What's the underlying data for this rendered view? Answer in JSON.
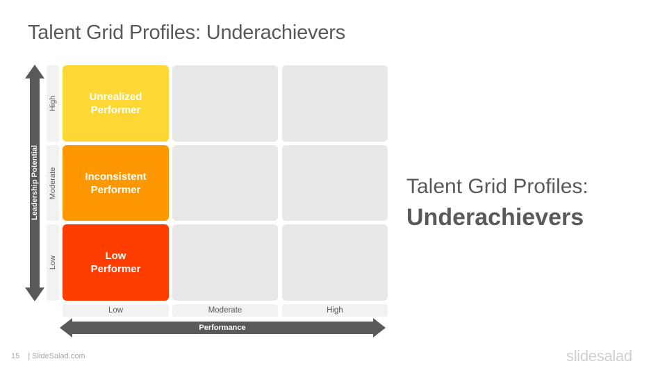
{
  "slide": {
    "title": "Talent Grid Profiles: Underachievers",
    "side_title_line1": "Talent Grid Profiles:",
    "side_title_line2": "Underachievers",
    "page_number": "15",
    "footer_text": "| SlideSalad.com",
    "logo": "slidesalad"
  },
  "grid": {
    "y_axis_label": "Leadership Potential",
    "x_axis_label": "Performance",
    "row_labels": [
      "High",
      "Moderate",
      "Low"
    ],
    "col_labels": [
      "Low",
      "Moderate",
      "High"
    ],
    "cells": [
      {
        "row": "High",
        "col": "Low",
        "line1": "Unrealized",
        "line2": "Performer",
        "color": "#fdd835"
      },
      {
        "row": "Moderate",
        "col": "Low",
        "line1": "Inconsistent",
        "line2": "Performer",
        "color": "#ff9800"
      },
      {
        "row": "Low",
        "col": "Low",
        "line1": "Low",
        "line2": "Performer",
        "color": "#ff3d00"
      }
    ],
    "empty_color": "#e8e8e8",
    "arrow_color": "#595959"
  }
}
